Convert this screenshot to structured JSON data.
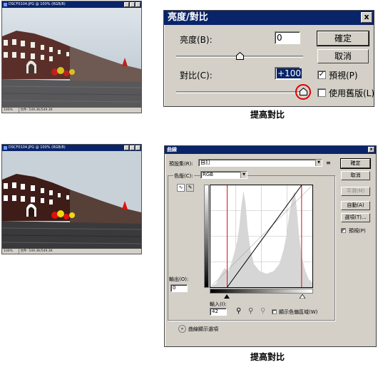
{
  "top_document": {
    "title": "DSCF0104.JPG @ 100% (RGB/8)",
    "zoom": "100%",
    "status": "文件: 549.3K/549.3K"
  },
  "bottom_document": {
    "title": "DSCF0104.JPG @ 100% (RGB/8)",
    "zoom": "100%",
    "status": "文件: 549.3K/549.3K"
  },
  "brightness_contrast": {
    "title": "亮度/對比",
    "close_label": "x",
    "brightness_label": "亮度(B):",
    "brightness_value": "0",
    "brightness_level": 0,
    "contrast_label": "對比(C):",
    "contrast_value": "+100",
    "contrast_level": 100,
    "ok_label": "確定",
    "cancel_label": "取消",
    "preview_label": "預視(P)",
    "preview_checked": "✓",
    "legacy_label": "使用舊版(L)",
    "legacy_checked": ""
  },
  "caption_top": "提高對比",
  "curves": {
    "title": "曲線",
    "close_label": "x",
    "preset_label": "預設集(R):",
    "preset_value": "自訂",
    "preset_menu_glyph": "≡",
    "channel_label": "色版(C):",
    "channel_value": "RGB",
    "output_label": "輸出(O):",
    "output_value": "0",
    "input_label": "輸入(I):",
    "input_value": "42",
    "show_clipping_label": "顯示色偏區域(W)",
    "show_clipping_checked": "",
    "display_options_label": "曲線顯示選項",
    "ok_label": "確定",
    "cancel_label": "取消",
    "smooth_label": "平滑(M)",
    "auto_label": "自動(A)",
    "options_label": "選項(T)...",
    "preview_label": "預視(P)",
    "preview_checked": "✓",
    "curve_points": [
      [
        42,
        0
      ],
      [
        228,
        255
      ]
    ],
    "accent_color": "#d01010"
  },
  "caption_bottom": "提高對比",
  "colors": {
    "title_bar": "#0a246a",
    "dialog_bg": "#d4d0c8",
    "marker_red": "#d01010"
  }
}
